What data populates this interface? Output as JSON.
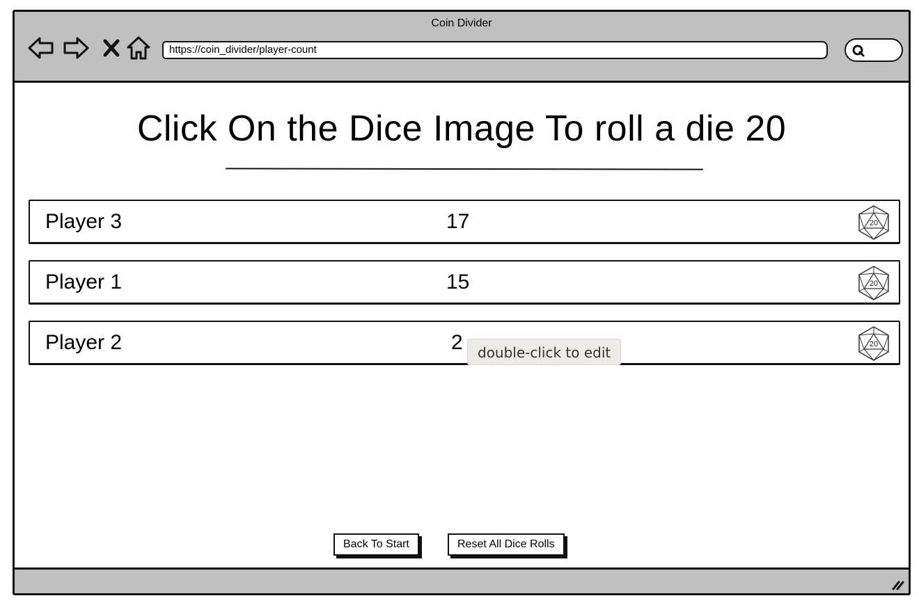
{
  "window": {
    "title": "Coin Divider",
    "url": "https://coin_divider/player-count"
  },
  "page": {
    "heading": "Click On the Dice Image To roll a die 20"
  },
  "players": [
    {
      "name": "Player 3",
      "score": "17"
    },
    {
      "name": "Player 1",
      "score": "15"
    },
    {
      "name": "Player 2",
      "score": "2"
    }
  ],
  "tooltip": "double-click to edit",
  "buttons": {
    "back": "Back To Start",
    "reset": "Reset All Dice Rolls"
  },
  "icons": {
    "nav": [
      "back-arrow-icon",
      "forward-arrow-icon",
      "close-icon",
      "home-icon"
    ],
    "search": "search-icon",
    "die": "d20-die-icon",
    "grip": "resize-grip-icon"
  },
  "colors": {
    "chrome": "#c0c0c0",
    "border": "#111111",
    "tooltip_bg": "#ecebe6"
  }
}
